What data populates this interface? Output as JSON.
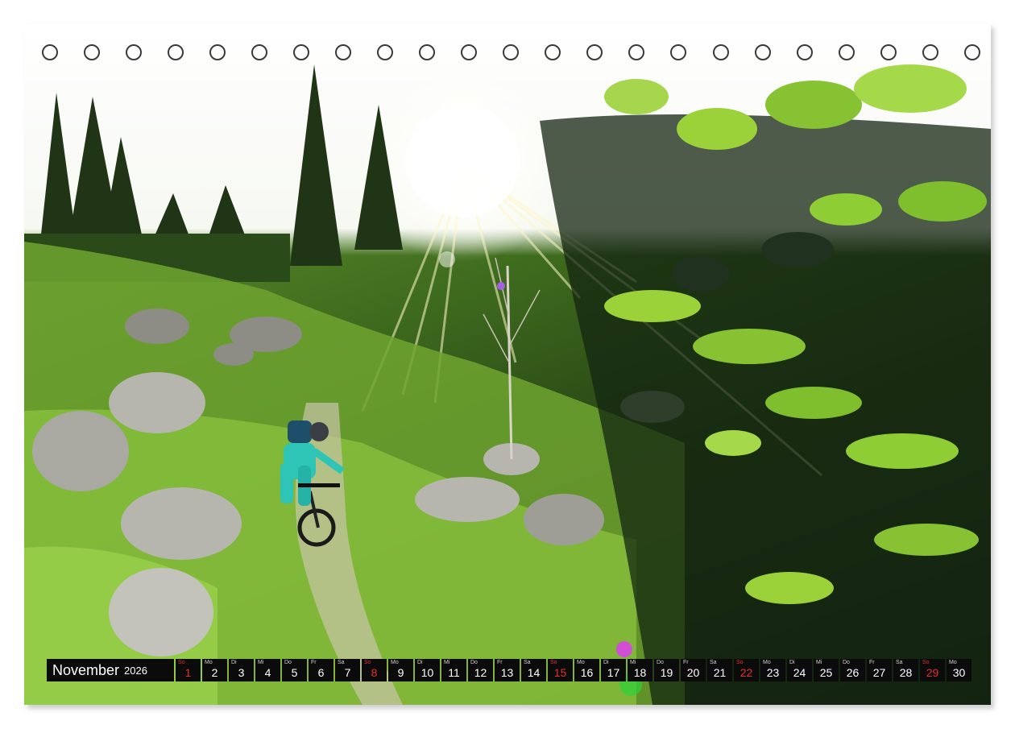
{
  "calendar": {
    "month": "November",
    "year": "2026",
    "binding_hole_count": 23,
    "weekend_color": "#e1302b",
    "days": [
      {
        "wd": "So",
        "d": "1",
        "weekend": true
      },
      {
        "wd": "Mo",
        "d": "2",
        "weekend": false
      },
      {
        "wd": "Di",
        "d": "3",
        "weekend": false
      },
      {
        "wd": "Mi",
        "d": "4",
        "weekend": false
      },
      {
        "wd": "Do",
        "d": "5",
        "weekend": false
      },
      {
        "wd": "Fr",
        "d": "6",
        "weekend": false
      },
      {
        "wd": "Sa",
        "d": "7",
        "weekend": false
      },
      {
        "wd": "So",
        "d": "8",
        "weekend": true
      },
      {
        "wd": "Mo",
        "d": "9",
        "weekend": false
      },
      {
        "wd": "Di",
        "d": "10",
        "weekend": false
      },
      {
        "wd": "Mi",
        "d": "11",
        "weekend": false
      },
      {
        "wd": "Do",
        "d": "12",
        "weekend": false
      },
      {
        "wd": "Fr",
        "d": "13",
        "weekend": false
      },
      {
        "wd": "Sa",
        "d": "14",
        "weekend": false
      },
      {
        "wd": "So",
        "d": "15",
        "weekend": true
      },
      {
        "wd": "Mo",
        "d": "16",
        "weekend": false
      },
      {
        "wd": "Di",
        "d": "17",
        "weekend": false
      },
      {
        "wd": "Mi",
        "d": "18",
        "weekend": false
      },
      {
        "wd": "Do",
        "d": "19",
        "weekend": false
      },
      {
        "wd": "Fr",
        "d": "20",
        "weekend": false
      },
      {
        "wd": "Sa",
        "d": "21",
        "weekend": false
      },
      {
        "wd": "So",
        "d": "22",
        "weekend": true
      },
      {
        "wd": "Mo",
        "d": "23",
        "weekend": false
      },
      {
        "wd": "Di",
        "d": "24",
        "weekend": false
      },
      {
        "wd": "Mi",
        "d": "25",
        "weekend": false
      },
      {
        "wd": "Do",
        "d": "26",
        "weekend": false
      },
      {
        "wd": "Fr",
        "d": "27",
        "weekend": false
      },
      {
        "wd": "Sa",
        "d": "28",
        "weekend": false
      },
      {
        "wd": "So",
        "d": "29",
        "weekend": true
      },
      {
        "wd": "Mo",
        "d": "30",
        "weekend": false
      }
    ]
  },
  "photo": {
    "scene": "mountain-biker-forest-trail",
    "colors": {
      "sky": "#ffffff",
      "grass": "#7cb83a",
      "foliage": "#9bd23a",
      "rock": "#b9b9b3",
      "jersey": "#2ec4b6"
    }
  }
}
